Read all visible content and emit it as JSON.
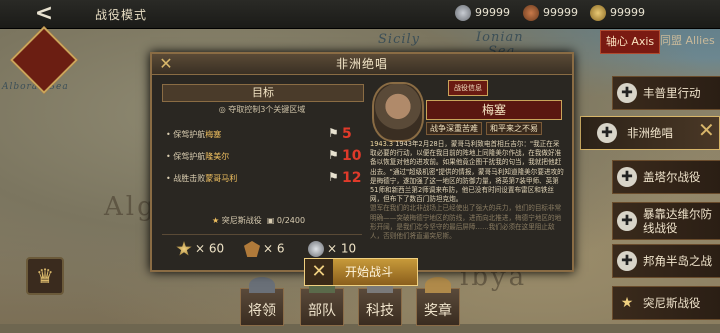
{
  "header": {
    "back_label": "<",
    "mode_title": "战役模式",
    "resources": [
      {
        "icon": "medal-icon",
        "value": "99999"
      },
      {
        "icon": "badge-icon",
        "value": "99999"
      },
      {
        "icon": "star-icon",
        "value": "99999"
      }
    ]
  },
  "map": {
    "labels": [
      "Sicily",
      "Ionian",
      "Sea",
      "Alboran Sea",
      "Alg",
      "ibya"
    ]
  },
  "sidebar": {
    "tabs": [
      {
        "label": "轴心 Axis",
        "active": true
      },
      {
        "label": "同盟 Allies",
        "active": false
      }
    ],
    "battles": [
      {
        "icon": "cross-icon",
        "label": "丰普里行动",
        "active": false
      },
      {
        "icon": "cross-icon",
        "label": "非洲绝唱",
        "active": true
      },
      {
        "icon": "cross-icon",
        "label": "盖塔尔战役",
        "active": false
      },
      {
        "icon": "cross-icon",
        "label": "暴靠达维尔防线战役",
        "active": false
      },
      {
        "icon": "cross-icon",
        "label": "邦角半岛之战",
        "active": false
      },
      {
        "icon": "star-icon",
        "label": "突尼斯战役",
        "active": false
      }
    ]
  },
  "bottom_menu": [
    {
      "label": "将领"
    },
    {
      "label": "部队"
    },
    {
      "label": "科技"
    },
    {
      "label": "奖章"
    }
  ],
  "dialog": {
    "title": "非洲绝唱",
    "objectives": {
      "heading": "目标",
      "subtitle": "夺取控制3个关键区域",
      "tasks": [
        {
          "prefix": "保驾护航",
          "name": "梅塞",
          "value": "5"
        },
        {
          "prefix": "保驾护航",
          "name": "隆美尔",
          "value": "10"
        },
        {
          "prefix": "战胜击败",
          "name": "蒙哥马利",
          "value": "12"
        }
      ],
      "progress_title": "突尼斯战役",
      "progress_value": "0/2400",
      "rewards": [
        {
          "icon": "gold-medal-icon",
          "value": "60"
        },
        {
          "icon": "bronze-badge-icon",
          "value": "6"
        },
        {
          "icon": "silver-medal-icon",
          "value": "10"
        }
      ]
    },
    "info": {
      "badge": "战役信息",
      "general_name": "梅塞",
      "traits": [
        "战争深重苦难",
        "和平来之不易"
      ],
      "story_date": "1943.3",
      "story_text": "1943年2月28日，蒙哥马利致电首相丘吉尔：\"我正在采取必要的行动，以便在我目前的阵地上同隆美尔作战，在我做好准备以恢复对他的进攻前。如果他竟企图干扰我的句当，我就把他赶出去。\"通过\"超级机密\"提供的情报，蒙哥马利知道隆美尔要进攻的是梅德宁，遂加强了这一地区的防御力量，将英第7装甲师、英第51师和新西兰第2师调来布防，他已没有时间设置布雷区和铁丝网，但布下了数百门防坦克炮。",
      "story_faded": "盟军在我们的北非战场上已经使出了强大的兵力，他们的目标非常明确——突破梅德宁地区的防线，进而向北推进，梅德宁地区的地形开阔，是我们迄今坚守的最后屏障……我们必须在这里阻止敌人，否则他们将直逼突尼斯。"
    },
    "start_button": "开始战斗"
  }
}
